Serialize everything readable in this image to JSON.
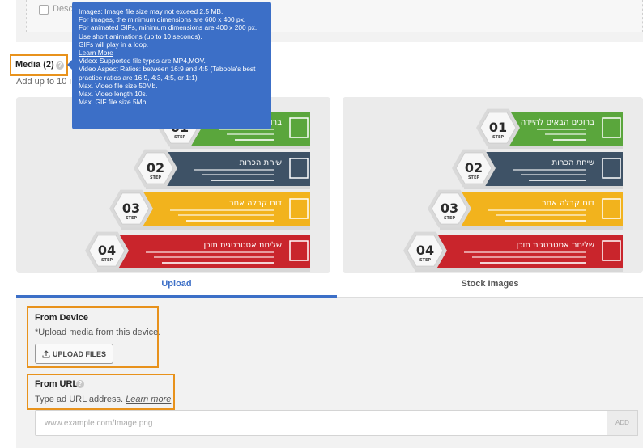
{
  "description": {
    "checkbox_label": "Desc"
  },
  "media": {
    "title": "Media (2)",
    "subtitle": "Add up to 10 i",
    "help_icon": "question-circle-icon"
  },
  "tooltip": {
    "line1": "Images: Image file size may not exceed 2.5 MB.",
    "line2": "For images, the minimum dimensions are 600 x 400 px.",
    "line3": "For animated GIFs, minimum dimensions are 400 x 200 px.",
    "line4": "Use short animations (up to 10 seconds).",
    "line5": "GIFs will play in a loop.",
    "learn_more": "Learn More",
    "line6": "Video: Supported file types are MP4,MOV.",
    "line7": "Video Aspect Ratios: between 16:9 and 4:5 (Taboola's best practice ratios are 16:9, 4:3, 4:5, or 1:1)",
    "line8": "Max. Video file size 50Mb.",
    "line9": "Max. Video length 10s.",
    "line10": "Max. GIF file size 5Mb."
  },
  "images": {
    "steps": [
      {
        "num": "01",
        "word": "STEP",
        "heading": "ברוכים הבאים להיידה",
        "color": "#5aa63c"
      },
      {
        "num": "02",
        "word": "STEP",
        "heading": "שיחת הכרות",
        "color": "#3e5266"
      },
      {
        "num": "03",
        "word": "STEP",
        "heading": "דוח קבלה אחר",
        "color": "#f2b31d"
      },
      {
        "num": "04",
        "word": "STEP",
        "heading": "שליחת אסטרטגית תוכן",
        "color": "#c9252c"
      }
    ]
  },
  "tabs": {
    "upload": "Upload",
    "stock": "Stock Images"
  },
  "from_device": {
    "title": "From Device",
    "text": "*Upload media from this device.",
    "button_label": "UPLOAD FILES",
    "button_icon": "upload-icon"
  },
  "from_url": {
    "title": "From URL",
    "text": "Type ad URL address.",
    "learn_more": "Learn more",
    "placeholder": "www.example.com/Image.png",
    "add_label": "ADD"
  },
  "colors": {
    "accent": "#3c6fc7",
    "highlight": "#e8921c"
  }
}
